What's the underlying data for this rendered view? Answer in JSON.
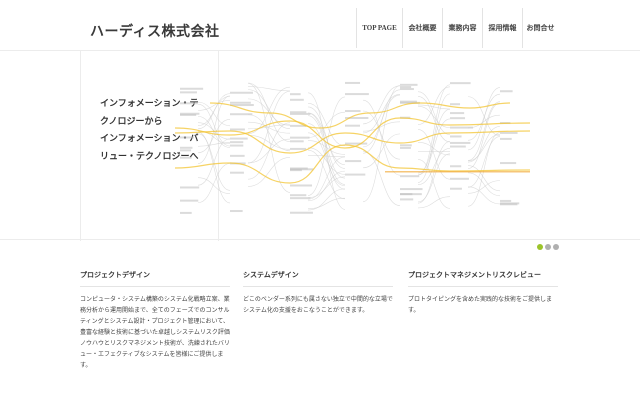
{
  "header": {
    "company_name": "ハーディス株式会社",
    "nav": [
      {
        "label": "TOP PAGE"
      },
      {
        "label": "会社概要"
      },
      {
        "label": "業務内容"
      },
      {
        "label": "採用情報"
      },
      {
        "label": "お問合せ"
      }
    ]
  },
  "hero": {
    "lines": [
      "インフォメーション・テ",
      "クノロジーから",
      "インフォメーション・バ",
      "リュー・テクノロジーへ"
    ],
    "graphic": "network-diagram",
    "slider": {
      "count": 3,
      "active_index": 0
    }
  },
  "colors": {
    "accent": "#9cc42a",
    "highlight": "#f3c431",
    "line": "#cfcfcf"
  },
  "columns": [
    {
      "title": "プロジェクトデザイン",
      "body": "コンピュータ・システム構築のシステム化戦略立案、業務分析から運用開始まで、全てのフェーズでのコンサルティングとシステム設計・プロジェクト管理において、豊富な経験と技術に基づいた卓越しシステムリスク評価ノウハウとリスクマネジメント技術が、洗練されたバリュー・エフェクティブなシステムを皆様にご提供します。"
    },
    {
      "title": "システムデザイン",
      "body": "どこのベンダー系列にも属さない独立で中間的な立場でシステム化の支援をおこなうことができます。"
    },
    {
      "title": "プロジェクトマネジメントリスクレビュー",
      "body": "プロトタイピングを含めた実践的な技術をご提供します。"
    }
  ]
}
